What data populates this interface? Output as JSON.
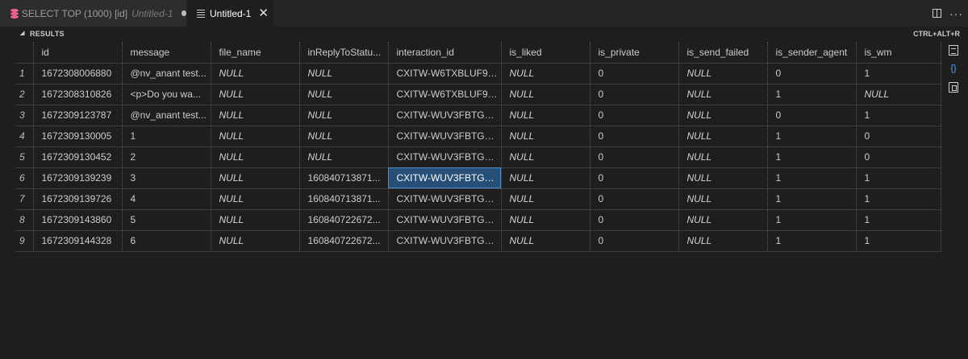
{
  "tabs": [
    {
      "title": "SELECT TOP (1000) [id]",
      "subtitle": "Untitled-1"
    },
    {
      "title": "Untitled-1",
      "close": "✕"
    }
  ],
  "results": {
    "label": "RESULTS",
    "caret": "◢",
    "shortcut": "CTRL+ALT+R"
  },
  "columns": [
    "id",
    "message",
    "file_name",
    "inReplyToStatu...",
    "interaction_id",
    "is_liked",
    "is_private",
    "is_send_failed",
    "is_sender_agent",
    "is_wm"
  ],
  "rows": [
    [
      "1",
      "1672308006880",
      "@nv_anant test...",
      "NULL",
      "NULL",
      "CXITW-W6TXBLUF9EG",
      "NULL",
      "0",
      "NULL",
      "0",
      "1"
    ],
    [
      "2",
      "1672308310826",
      "<p>Do you wa...",
      "NULL",
      "NULL",
      "CXITW-W6TXBLUF9EG",
      "NULL",
      "0",
      "NULL",
      "1",
      "NULL"
    ],
    [
      "3",
      "1672309123787",
      "@nv_anant test...",
      "NULL",
      "NULL",
      "CXITW-WUV3FBTGKEZ",
      "NULL",
      "0",
      "NULL",
      "0",
      "1"
    ],
    [
      "4",
      "1672309130005",
      "1",
      "NULL",
      "NULL",
      "CXITW-WUV3FBTGKEZ",
      "NULL",
      "0",
      "NULL",
      "1",
      "0"
    ],
    [
      "5",
      "1672309130452",
      "2",
      "NULL",
      "NULL",
      "CXITW-WUV3FBTGKEZ",
      "NULL",
      "0",
      "NULL",
      "1",
      "0"
    ],
    [
      "6",
      "1672309139239",
      "3",
      "NULL",
      "160840713871...",
      "CXITW-WUV3FBTGKEZ",
      "NULL",
      "0",
      "NULL",
      "1",
      "1"
    ],
    [
      "7",
      "1672309139726",
      "4",
      "NULL",
      "160840713871...",
      "CXITW-WUV3FBTGKEZ",
      "NULL",
      "0",
      "NULL",
      "1",
      "1"
    ],
    [
      "8",
      "1672309143860",
      "5",
      "NULL",
      "160840722672...",
      "CXITW-WUV3FBTGKEZ",
      "NULL",
      "0",
      "NULL",
      "1",
      "1"
    ],
    [
      "9",
      "1672309144328",
      "6",
      "NULL",
      "160840722672...",
      "CXITW-WUV3FBTGKEZ",
      "NULL",
      "0",
      "NULL",
      "1",
      "1"
    ]
  ],
  "selected_cell": {
    "row": 5,
    "col": 5
  },
  "icons": [
    "database-icon",
    "file-icon",
    "split-editor-icon",
    "more-actions-icon",
    "save-as-csv-icon",
    "save-as-json-icon",
    "save-as-excel-icon"
  ],
  "colors": {
    "background": "#1e1e1e",
    "selection": "#264f78",
    "db_icon": "#f06292"
  }
}
